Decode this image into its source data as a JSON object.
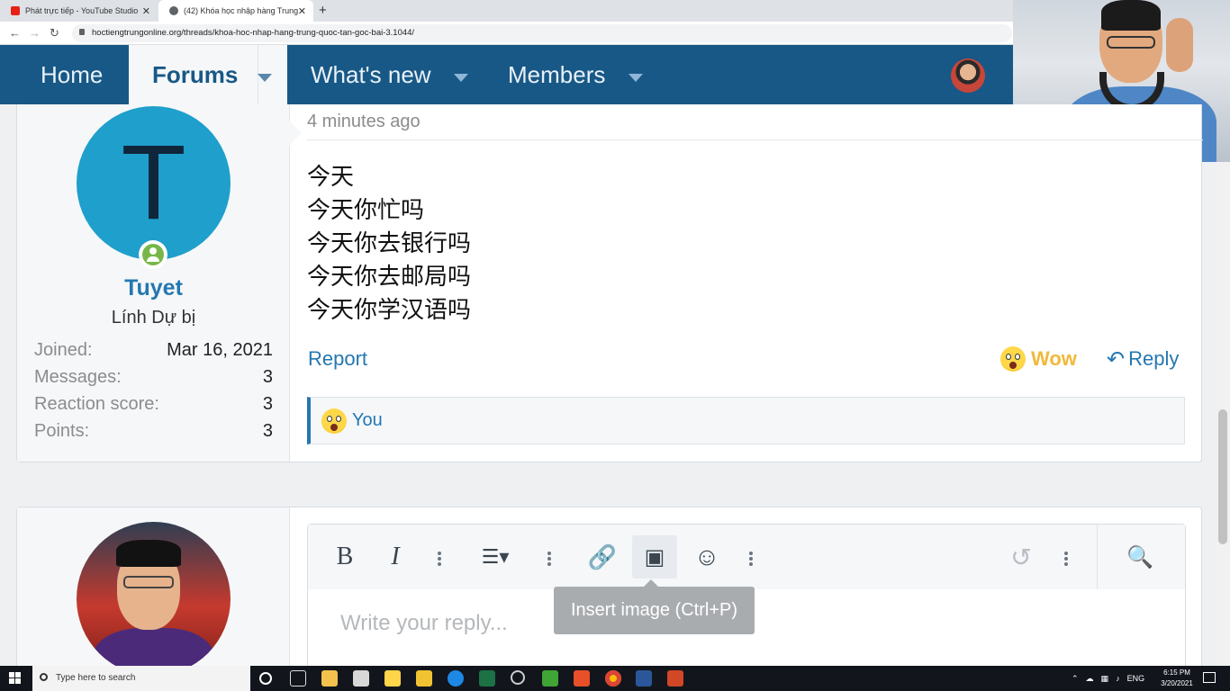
{
  "browser": {
    "tabs": [
      {
        "label": "Phát trực tiếp - YouTube Studio",
        "close": "✕",
        "color": "#e62117"
      },
      {
        "label": "(42) Khóa học nhập hàng Trung",
        "close": "✕",
        "color": "#5f6368"
      }
    ],
    "new_tab": "+",
    "url": "hoctiengtrungonline.org/threads/khoa-hoc-nhap-hang-trung-quoc-tan-goc-bai-3.1044/"
  },
  "nav": {
    "home": "Home",
    "forums": "Forums",
    "whats_new": "What's new",
    "members": "Members"
  },
  "post": {
    "avatar_letter": "T",
    "username": "Tuyet",
    "user_title": "Lính Dự bị",
    "stats": [
      {
        "label": "Joined:",
        "value": "Mar 16, 2021"
      },
      {
        "label": "Messages:",
        "value": "3"
      },
      {
        "label": "Reaction score:",
        "value": "3"
      },
      {
        "label": "Points:",
        "value": "3"
      }
    ],
    "time": "4 minutes ago",
    "lines": [
      "今天",
      "今天你忙吗",
      "今天你去银行吗",
      "今天你去邮局吗",
      "今天你学汉语吗"
    ],
    "report": "Report",
    "wow": "Wow",
    "reply": "Reply",
    "reactions_by": "You"
  },
  "editor": {
    "placeholder": "Write your reply...",
    "tooltip": "Insert image (Ctrl+P)",
    "bold": "B",
    "italic": "I"
  },
  "taskbar": {
    "search": "Type here to search",
    "lang": "ENG",
    "time": "6:15 PM",
    "date": "3/20/2021"
  },
  "colors": {
    "nav_bg": "#185886",
    "link": "#2577b1",
    "avatar_bg": "#1f9fcc",
    "wow": "#f0b93a",
    "online": "#77b74a"
  }
}
